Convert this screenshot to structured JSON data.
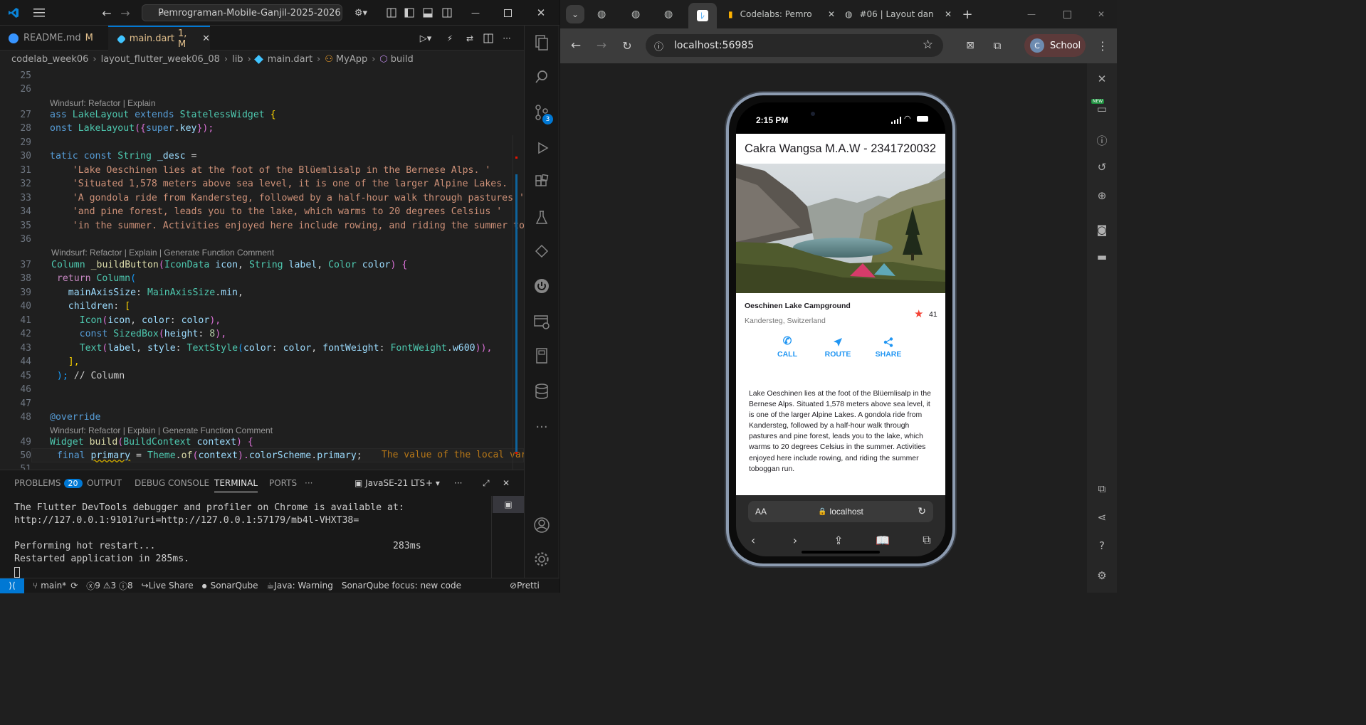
{
  "vscode": {
    "search_text": "Pemrograman-Mobile-Ganjil-2025-2026",
    "tabs": [
      {
        "label": "README.md",
        "status": "M"
      },
      {
        "label": "main.dart",
        "status": "1, M"
      }
    ],
    "breadcrumb": [
      "codelab_week06",
      "layout_flutter_week06_08",
      "lib",
      "main.dart",
      "MyApp",
      "build"
    ],
    "line_numbers": [
      "25",
      "26",
      "27",
      "28",
      "29",
      "30",
      "31",
      "32",
      "33",
      "34",
      "35",
      "36",
      "37",
      "38",
      "39",
      "40",
      "41",
      "42",
      "43",
      "44",
      "45",
      "46",
      "47",
      "48",
      "49",
      "50",
      "51"
    ],
    "codelens": [
      "Windsurf: Refactor | Explain",
      "Windsurf: Refactor | Explain | Generate Function Comment",
      "Windsurf: Refactor | Explain | Generate Function Comment"
    ],
    "code": {
      "l27a": "ass ",
      "l27b": "LakeLayout",
      "l27c": " extends ",
      "l27d": "StatelessWidget",
      "l27e": " {",
      "l28a": "onst ",
      "l28b": "LakeLayout",
      "l28c": "({",
      "l28d": "super",
      "l28e": ".",
      "l28f": "key",
      "l28g": "});",
      "l30a": "tatic const ",
      "l30b": "String",
      "l30c": " _desc",
      "l30d": " =",
      "l31": "    'Lake Oeschinen lies at the foot of the Blüemlisalp in the Bernese Alps. '",
      "l32": "    'Situated 1,578 meters above sea level, it is one of the larger Alpine Lakes. '",
      "l33": "    'A gondola ride from Kandersteg, followed by a half-hour walk through pastures '",
      "l34": "    'and pine forest, leads you to the lake, which warms to 20 degrees Celsius '",
      "l35": "    'in the summer. Activities enjoyed here include rowing, and riding the summer tob",
      "l37a": "Column",
      "l37b": " _buildButton",
      "l37c": "(",
      "l37d": "IconData",
      "l37e": " icon",
      "l37f": ", ",
      "l37g": "String",
      "l37h": " label",
      "l37i": ", ",
      "l37j": "Color",
      "l37k": " color",
      "l37l": ") {",
      "l38a": "  return ",
      "l38b": "Column",
      "l38c": "(",
      "l39a": "    mainAxisSize",
      "l39b": ": ",
      "l39c": "MainAxisSize",
      "l39d": ".",
      "l39e": "min",
      "l39f": ",",
      "l40a": "    children",
      "l40b": ": ",
      "l40c": "[",
      "l41a": "      Icon",
      "l41b": "(",
      "l41c": "icon",
      "l41d": ", ",
      "l41e": "color",
      "l41f": ": ",
      "l41g": "color",
      "l41h": "),",
      "l42a": "      const ",
      "l42b": "SizedBox",
      "l42c": "(",
      "l42d": "height",
      "l42e": ": ",
      "l42f": "8",
      "l42g": "),",
      "l43a": "      Text",
      "l43b": "(",
      "l43c": "label",
      "l43d": ", ",
      "l43e": "style",
      "l43f": ": ",
      "l43g": "TextStyle",
      "l43h": "(",
      "l43i": "color",
      "l43j": ": ",
      "l43k": "color",
      "l43l": ", ",
      "l43m": "fontWeight",
      "l43n": ": ",
      "l43o": "FontWeight",
      "l43p": ".",
      "l43q": "w600",
      "l43r": ")),",
      "l44": "    ],",
      "l45a": "  ); ",
      "l45b": "// Column",
      "l46": "",
      "l48": "@override",
      "l49a": "Widget",
      "l49b": " build",
      "l49c": "(",
      "l49d": "BuildContext",
      "l49e": " context",
      "l49f": ") {",
      "l50a": "  final ",
      "l50b": "primary",
      "l50c": " = ",
      "l50d": "Theme",
      "l50e": ".",
      "l50f": "of",
      "l50g": "(",
      "l50h": "context",
      "l50i": ").",
      "l50j": "colorScheme",
      "l50k": ".",
      "l50l": "primary",
      "l50m": ";"
    },
    "inline_message": "The value of the local var",
    "panel": {
      "tabs": [
        "PROBLEMS",
        "OUTPUT",
        "DEBUG CONSOLE",
        "TERMINAL",
        "PORTS"
      ],
      "problems_count": "20",
      "terminal_profile": "JavaSE-21 LTS",
      "terminal_lines": [
        "The Flutter DevTools debugger and profiler on Chrome is available at:",
        "http://127.0.0.1:9101?uri=http://127.0.0.1:57179/mb4l-VHXT38=",
        "",
        "Performing hot restart...                                          283ms",
        "Restarted application in 285ms."
      ]
    },
    "activity_badge": "3",
    "status": {
      "branch": "main*",
      "errors": "9",
      "warnings": "3",
      "info": "8",
      "live_share": "Live Share",
      "sonarqube": "SonarQube",
      "java": "Java: Warning",
      "sonar_focus": "SonarQube focus: new code",
      "prettier": "Pretti"
    }
  },
  "chrome": {
    "tabs": [
      {
        "label": "Codelabs: Pemro"
      },
      {
        "label": "#06 | Layout dan"
      }
    ],
    "url": "localhost:56985",
    "profile": "School",
    "profile_initial": "C",
    "new_badge": "NEW"
  },
  "phone": {
    "time": "2:15 PM",
    "app_title": "Cakra Wangsa M.A.W - 2341720032",
    "place_name": "Oeschinen Lake Campground",
    "place_location": "Kandersteg, Switzerland",
    "rating": "41",
    "buttons": [
      "CALL",
      "ROUTE",
      "SHARE"
    ],
    "description": "Lake Oeschinen lies at the foot of the Blüemlisalp in the Bernese Alps. Situated 1,578 meters above sea level, it is one of the larger Alpine Lakes. A gondola ride from Kandersteg, followed by a half-hour walk through pastures and pine forest, leads you to the lake, which warms to 20 degrees Celsius in the summer. Activities enjoyed here include rowing, and riding the summer toboggan run.",
    "safari_aa": "AA",
    "safari_host": "localhost",
    "colors": {
      "accent": "#2196f3",
      "star": "#f44336"
    }
  }
}
